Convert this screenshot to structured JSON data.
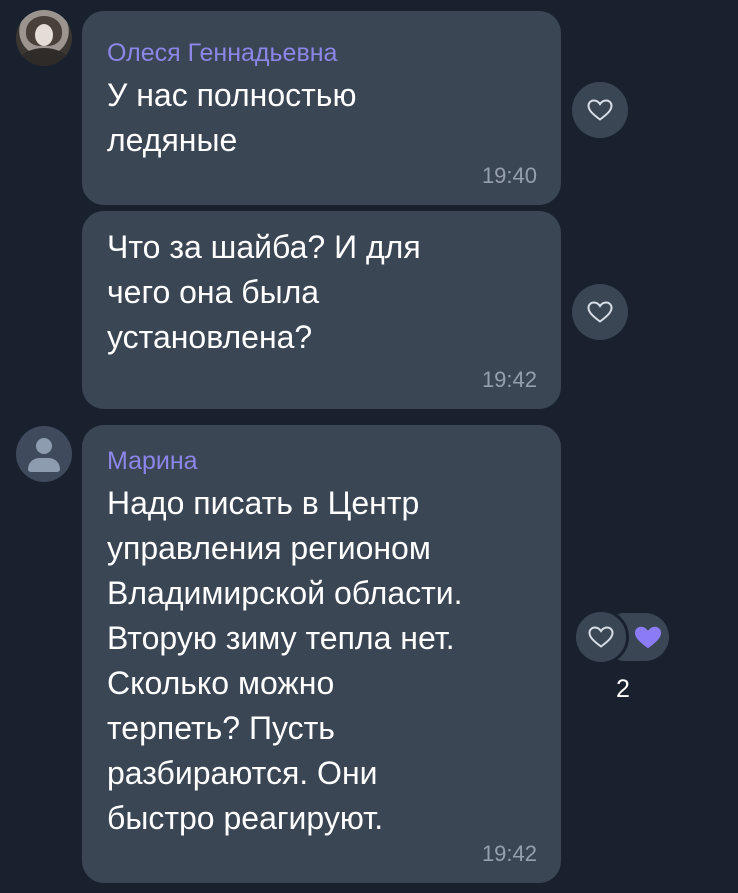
{
  "messages": [
    {
      "sender": "Олеся Геннадьевна",
      "text": "У нас полностью\nледяные",
      "time": "19:40"
    },
    {
      "text": "Что за шайба? И для\nчего она была\nустановлена?",
      "time": "19:42"
    },
    {
      "sender": "Марина",
      "text": "Надо писать в Центр\nуправления регионом\nВладимирской области.\nВторую зиму тепла нет.\nСколько можно\nтерпеть? Пусть\nразбираются. Они\nбыстро реагируют.",
      "time": "19:42",
      "reaction_count": "2"
    }
  ],
  "icons": {
    "reaction_outline": "heart-outline-icon",
    "reaction_filled": "heart-filled-icon"
  },
  "colors": {
    "background": "#19212e",
    "bubble": "#3b4655",
    "sender_name": "#8c86e8",
    "reaction_filled": "#8b7cf6",
    "time": "#96a0ad"
  }
}
